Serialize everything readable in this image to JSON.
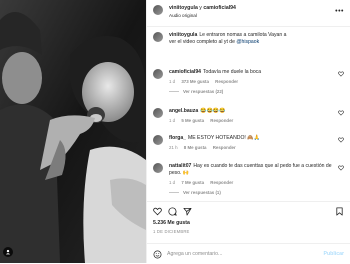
{
  "header": {
    "user1": "viniitoygula",
    "conjunction": "y",
    "user2": "camioficial94",
    "audio": "Audio original",
    "more_icon": "more-horizontal-icon"
  },
  "caption": {
    "username": "viniitoygula",
    "text_before": "Le entraron nomas a camilota Vayan a ver el video completo al yt de ",
    "mention": "@hispaok"
  },
  "comments": [
    {
      "username": "camioficial94",
      "text": "Todavía me duele la boca",
      "time": "1 d",
      "likes": "373 Me gusta",
      "reply": "Responder",
      "view_replies": "Ver respuestas (22)"
    },
    {
      "username": "angel.bauza",
      "text": "😂😂😂😂",
      "time": "1 d",
      "likes": "5 Me gusta",
      "reply": "Responder"
    },
    {
      "username": "florga_",
      "text": "ME ESTOY HOTEANDO! 🙈🙏",
      "time": "21 h",
      "likes": "8 Me gusta",
      "reply": "Responder"
    },
    {
      "username": "nattalit07",
      "text": "Hay es cuando te das cuenttas que al pedo fue a cuestión de peso. 🙌",
      "time": "1 d",
      "likes": "7 Me gusta",
      "reply": "Responder",
      "view_replies": "Ver respuestas (1)"
    }
  ],
  "stats": {
    "likes": "5.236 Me gusta",
    "date": "1 DE DICIEMBRE"
  },
  "composer": {
    "placeholder": "Agrega un comentario...",
    "post_label": "Publicar"
  },
  "colors": {
    "link": "#00376b",
    "secondary_text": "#8e8e8e",
    "post_disabled": "#b2dffc",
    "divider": "#efefef"
  }
}
